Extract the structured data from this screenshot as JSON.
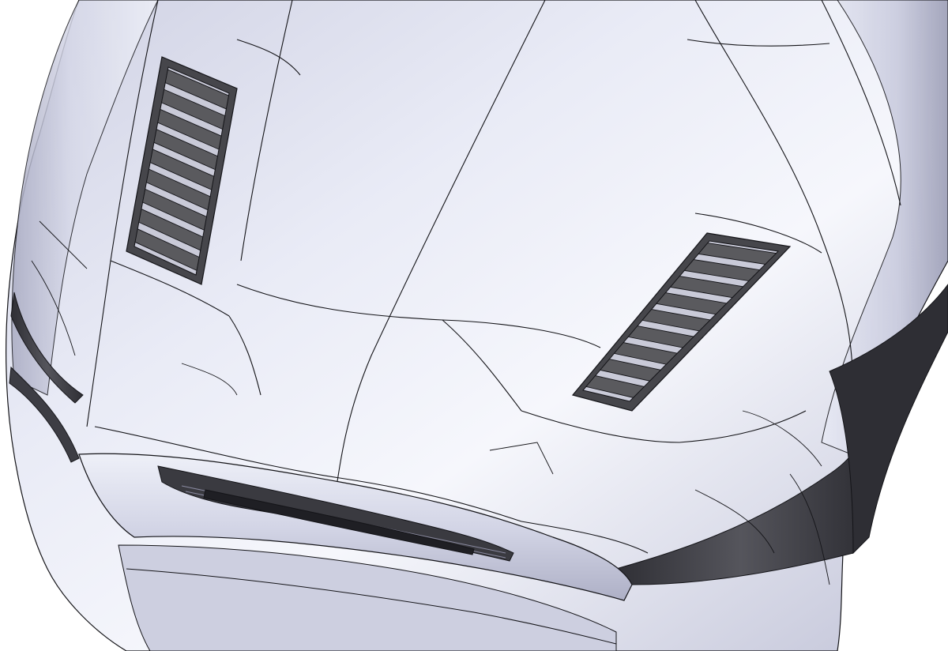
{
  "scene": {
    "subject": "car-hood-cad-model",
    "view": "front-three-quarter-top",
    "render_style": "shaded-with-edges",
    "colors": {
      "background": "#ffffff",
      "body_light": "#eceef8",
      "body_mid": "#c8cadf",
      "body_dark": "#8e90a8",
      "edge_line": "#141418",
      "vent_frame": "#3a3a3d",
      "louver": "#5a5a5e",
      "louver_gap": "#c9cad8",
      "grille": "#2a2a2e",
      "dark_trim": "#3d3d44"
    },
    "parts": {
      "hood_vents": [
        {
          "id": "left",
          "louver_count": 9
        },
        {
          "id": "right",
          "louver_count": 9
        }
      ],
      "grille_slot": {
        "present": true
      },
      "headlights": [
        {
          "id": "left"
        },
        {
          "id": "right"
        }
      ]
    }
  }
}
